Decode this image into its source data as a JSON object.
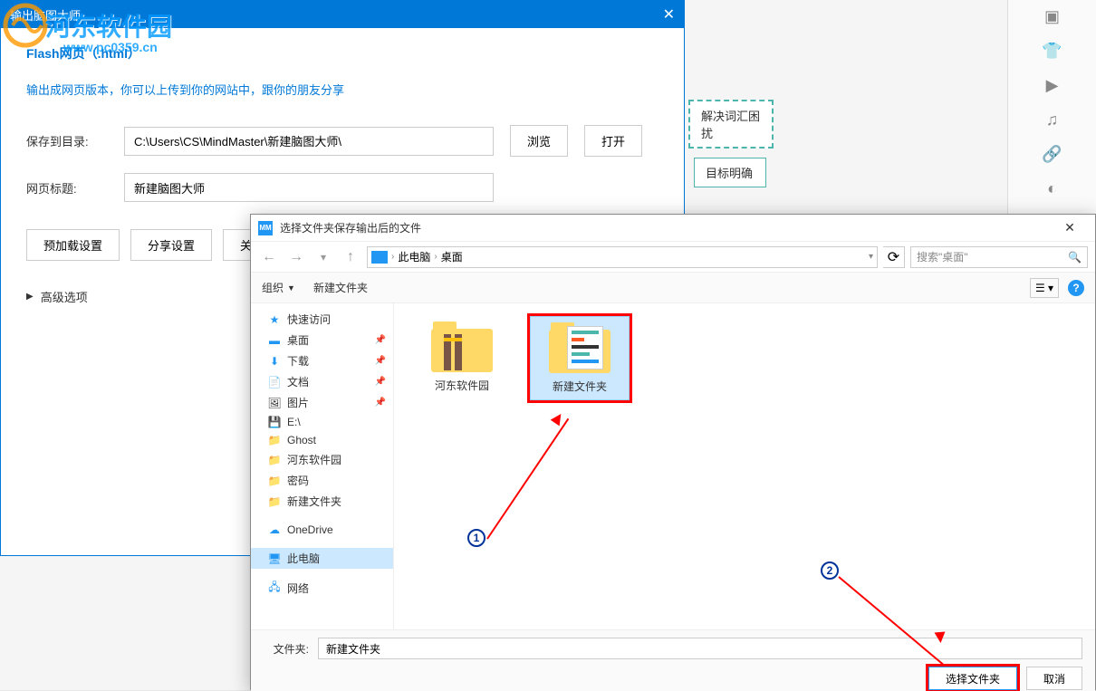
{
  "canvas": {
    "nodes": [
      {
        "label": "解决词汇困扰"
      },
      {
        "label": "目标明确"
      }
    ]
  },
  "right_tools": {
    "icons": [
      "comment-icon",
      "shirt-icon",
      "play-icon",
      "music-icon",
      "link-icon",
      "toggle-icon",
      "text-icon"
    ]
  },
  "export": {
    "window_title": "输出脑图大师",
    "subtitle": "Flash网页（.html）",
    "desc": "输出成网页版本，你可以上传到你的网站中，跟你的朋友分享",
    "save_dir_label": "保存到目录:",
    "save_dir_value": "C:\\Users\\CS\\MindMaster\\新建脑图大师\\",
    "browse": "浏览",
    "open": "打开",
    "page_title_label": "网页标题:",
    "page_title_value": "新建脑图大师",
    "preload": "预加载设置",
    "share": "分享设置",
    "about": "关于",
    "advanced": "高级选项"
  },
  "watermark": {
    "text": "河东软件园",
    "url": "www.pc0359.cn"
  },
  "file_dialog": {
    "title": "选择文件夹保存输出后的文件",
    "breadcrumb": {
      "root": "此电脑",
      "current": "桌面"
    },
    "search_placeholder": "搜索\"桌面\"",
    "toolbar": {
      "organize": "组织",
      "new_folder": "新建文件夹"
    },
    "tree": {
      "quick_access": "快速访问",
      "desktop": "桌面",
      "downloads": "下载",
      "documents": "文档",
      "pictures": "图片",
      "drive_e": "E:\\",
      "ghost": "Ghost",
      "hedong": "河东软件园",
      "password": "密码",
      "new_folder_item": "新建文件夹",
      "onedrive": "OneDrive",
      "this_pc": "此电脑",
      "network": "网络"
    },
    "content": {
      "folder1_name": "河东软件园",
      "folder2_name": "新建文件夹"
    },
    "footer": {
      "folder_label": "文件夹:",
      "folder_value": "新建文件夹",
      "select_button": "选择文件夹",
      "cancel_button": "取消"
    }
  },
  "annotations": {
    "num1": "1",
    "num2": "2"
  }
}
